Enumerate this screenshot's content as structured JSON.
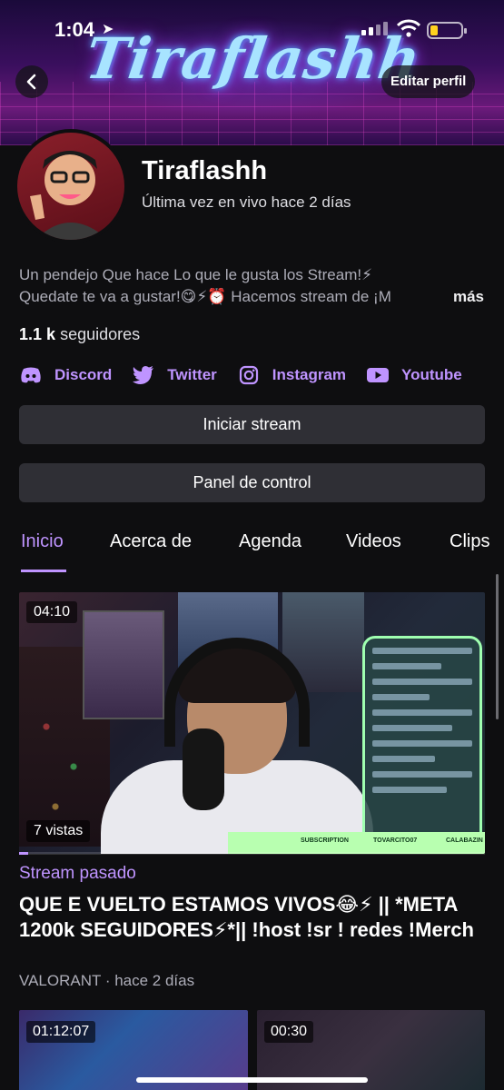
{
  "status_bar": {
    "time": "1:04"
  },
  "banner": {
    "title": "Tiraflashh"
  },
  "header": {
    "edit_profile": "Editar perfil"
  },
  "channel": {
    "name": "Tiraflashh",
    "last_live": "Última vez en vivo hace 2 días",
    "bio_line1": "Un pendejo Que hace Lo que le gusta los Stream!⚡",
    "bio_line2": "Quedate te va a gustar!😋⚡⏰ Hacemos stream de ¡M",
    "bio_more": "más",
    "followers_count": "1.1 k",
    "followers_label": "seguidores"
  },
  "socials": [
    {
      "label": "Discord",
      "icon": "discord-icon"
    },
    {
      "label": "Twitter",
      "icon": "twitter-icon"
    },
    {
      "label": "Instagram",
      "icon": "instagram-icon"
    },
    {
      "label": "Youtube",
      "icon": "youtube-icon"
    }
  ],
  "buttons": {
    "start_stream": "Iniciar stream",
    "control_panel": "Panel de control"
  },
  "tabs": [
    {
      "label": "Inicio",
      "active": true
    },
    {
      "label": "Acerca de",
      "active": false
    },
    {
      "label": "Agenda",
      "active": false
    },
    {
      "label": "Videos",
      "active": false
    },
    {
      "label": "Clips",
      "active": false
    }
  ],
  "featured_video": {
    "duration": "04:10",
    "views": "7 vistas",
    "type_label": "Stream pasado",
    "title": "QUE E VUELTO ESTAMOS VIVOS😂⚡  || *META 1200k SEGUIDORES⚡*|| !host !sr ! redes !Merch",
    "game": "VALORANT",
    "time_ago": "hace 2 días",
    "watch_progress": 0.02
  },
  "more_videos": [
    {
      "duration": "01:12:07"
    },
    {
      "duration": "00:30"
    }
  ],
  "colors": {
    "accent": "#bf94ff",
    "background": "#0e0e10",
    "button": "#2f2f35"
  }
}
